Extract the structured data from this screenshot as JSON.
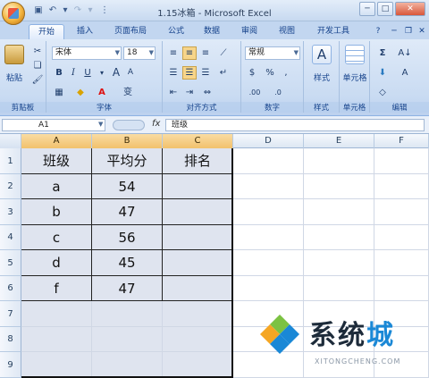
{
  "window": {
    "title": "1.15冰箱 - Microsoft Excel",
    "controls": [
      "─",
      "□",
      "✕"
    ]
  },
  "tabs": [
    "开始",
    "插入",
    "页面布局",
    "公式",
    "数据",
    "审阅",
    "视图",
    "开发工具"
  ],
  "ribbon": {
    "clipboard": {
      "label": "剪贴板",
      "paste": "粘贴"
    },
    "font": {
      "label": "字体",
      "name": "宋体",
      "size": "18",
      "bold": "B",
      "italic": "I",
      "underline": "U",
      "grow": "A",
      "shrink": "A",
      "color_btn": "A",
      "phonetic": "变"
    },
    "alignment": {
      "label": "对齐方式"
    },
    "number": {
      "label": "数字",
      "format": "常规",
      "currency": "%",
      "comma": ",",
      "increase_decimal": ".00",
      "decrease_decimal": ".0"
    },
    "styles": {
      "label": "样式",
      "button": "样式"
    },
    "cells": {
      "label": "单元格",
      "button": "单元格"
    },
    "editing": {
      "label": "编辑",
      "sum": "Σ",
      "sort": "A↓",
      "find": "A"
    }
  },
  "formula_bar": {
    "name_box": "A1",
    "fx": "fx",
    "value": "班级"
  },
  "columns": [
    "A",
    "B",
    "C",
    "D",
    "E",
    "F"
  ],
  "rows": [
    "1",
    "2",
    "3",
    "4",
    "5",
    "6",
    "7",
    "8",
    "9"
  ],
  "table": [
    [
      "班级",
      "平均分",
      "排名"
    ],
    [
      "a",
      "54",
      ""
    ],
    [
      "b",
      "47",
      ""
    ],
    [
      "c",
      "56",
      ""
    ],
    [
      "d",
      "45",
      ""
    ],
    [
      "f",
      "47",
      ""
    ]
  ],
  "watermark": {
    "title_main": "系统",
    "title_accent": "城",
    "url": "XITONGCHENG.COM"
  },
  "colors": {
    "ribbon": "#dfeaf8",
    "selection": "#dfe4ef",
    "accent": "#1a88d6"
  }
}
